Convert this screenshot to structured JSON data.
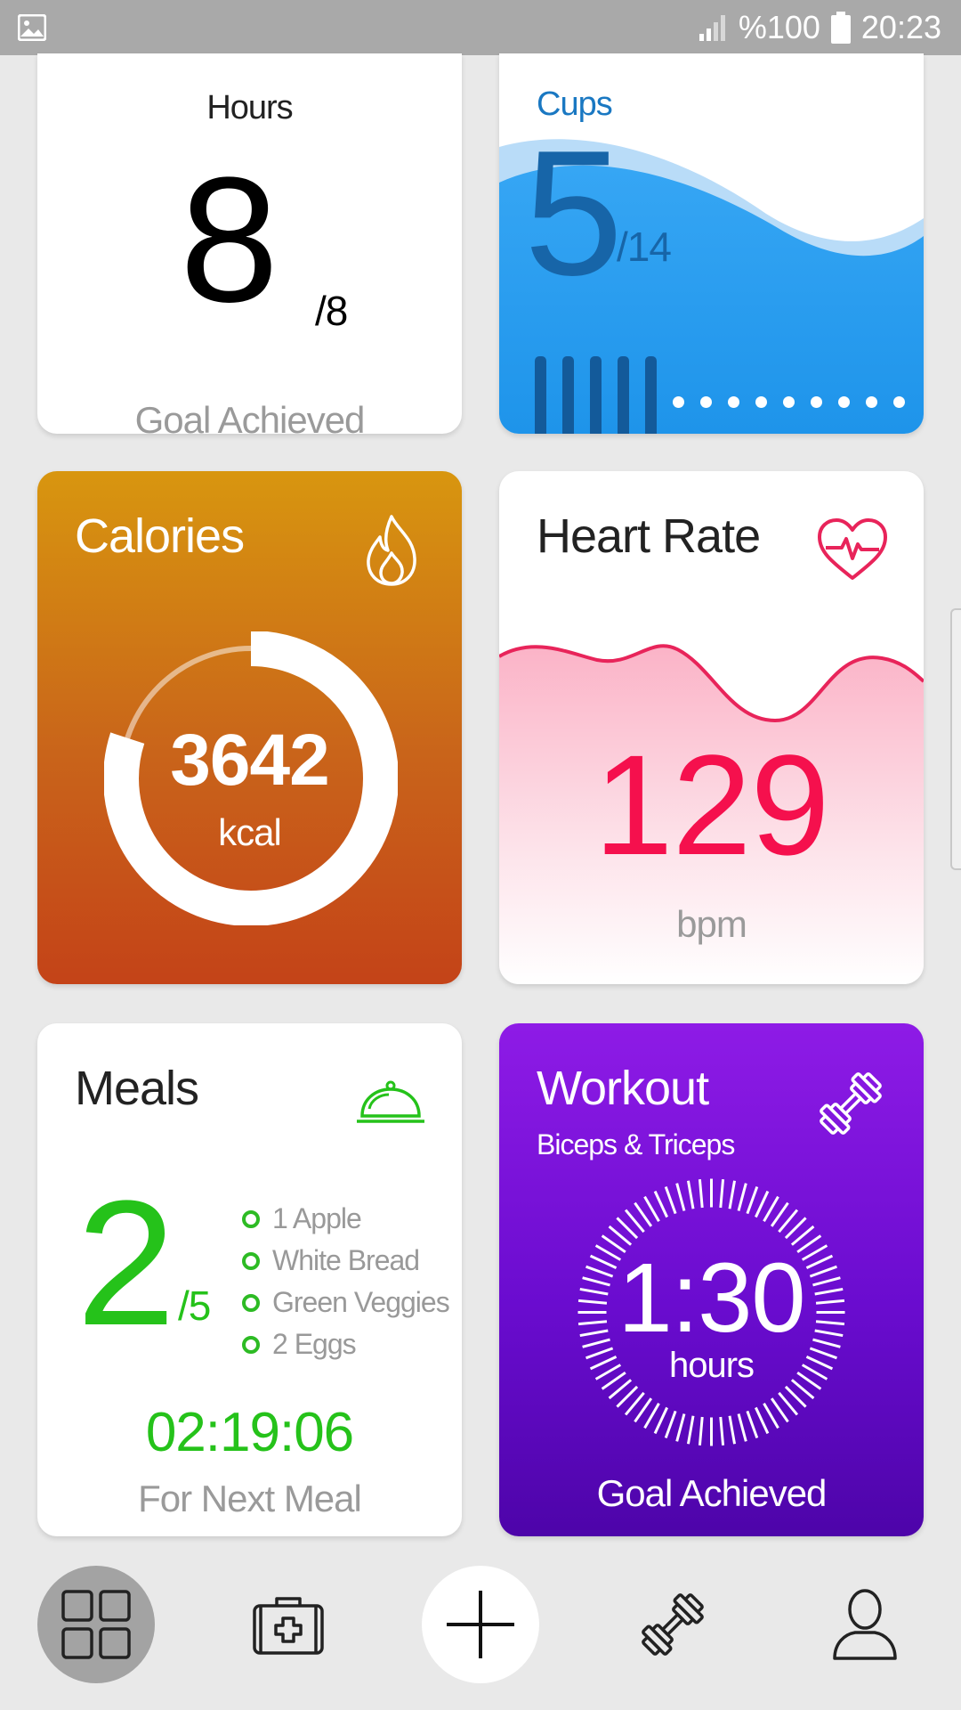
{
  "status_bar": {
    "battery_percent": "%100",
    "time": "20:23",
    "icons": [
      "gallery-icon",
      "signal-icon",
      "battery-icon"
    ]
  },
  "sleep": {
    "label": "Hours",
    "value": "8",
    "total": "/8",
    "status": "Goal Achieved"
  },
  "water": {
    "label": "Cups",
    "value": "5",
    "total": "/14",
    "filled_cups": 5,
    "total_cups": 14
  },
  "calories": {
    "title": "Calories",
    "value": "3642",
    "unit": "kcal",
    "progress": 0.8,
    "icon": "fire-icon"
  },
  "heart_rate": {
    "title": "Heart Rate",
    "value": "129",
    "unit": "bpm",
    "icon": "heart-pulse-icon",
    "color": "#f5104d"
  },
  "meals": {
    "title": "Meals",
    "value": "2",
    "total": "/5",
    "items": [
      "1 Apple",
      "White Bread",
      "Green Veggies",
      "2 Eggs"
    ],
    "countdown": "02:19:06",
    "countdown_label": "For Next Meal",
    "icon": "cloche-icon",
    "color": "#25c21a"
  },
  "workout": {
    "title": "Workout",
    "subtitle": "Biceps & Triceps",
    "time": "1:30",
    "unit": "hours",
    "status": "Goal Achieved",
    "icon": "dumbbell-icon"
  },
  "bottom_nav": {
    "items": [
      "dashboard-icon",
      "medical-kit-icon",
      "add-icon",
      "dumbbell-icon",
      "profile-icon"
    ],
    "active": "dashboard-icon"
  }
}
